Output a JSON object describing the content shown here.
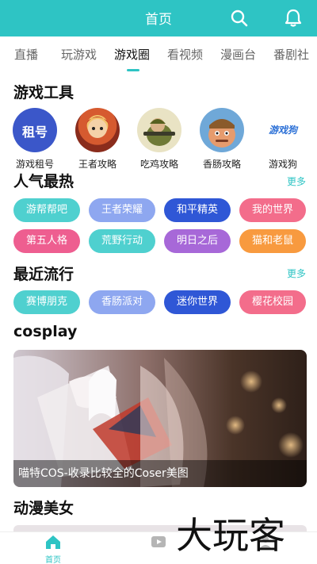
{
  "header": {
    "title": "首页",
    "accent_color": "#2ec4c4"
  },
  "tabs": [
    {
      "label": "直播"
    },
    {
      "label": "玩游戏"
    },
    {
      "label": "游戏圈"
    },
    {
      "label": "看视频"
    },
    {
      "label": "漫画台"
    },
    {
      "label": "番剧社"
    }
  ],
  "active_tab": "游戏圈",
  "tools": {
    "title": "游戏工具",
    "items": [
      {
        "label": "游戏租号",
        "icon": "rent-account-logo",
        "logo_text": "租号"
      },
      {
        "label": "王者攻略",
        "icon": "hero-avatar"
      },
      {
        "label": "吃鸡攻略",
        "icon": "soldier-avatar"
      },
      {
        "label": "香肠攻略",
        "icon": "sausage-man-avatar"
      },
      {
        "label": "游戏狗",
        "icon": "youxigou-logo",
        "logo_text": "游戏狗"
      }
    ]
  },
  "popular": {
    "title": "人气最热",
    "more": "更多",
    "items": [
      {
        "label": "游帮帮吧",
        "color": "#4fd0cf"
      },
      {
        "label": "王者荣耀",
        "color": "#8ea7f0"
      },
      {
        "label": "和平精英",
        "color": "#2f57d6"
      },
      {
        "label": "我的世界",
        "color": "#f36d8b"
      },
      {
        "label": "第五人格",
        "color": "#ee5e90"
      },
      {
        "label": "荒野行动",
        "color": "#4fd0cf"
      },
      {
        "label": "明日之后",
        "color": "#a768d8"
      },
      {
        "label": "猫和老鼠",
        "color": "#f89a3f"
      }
    ]
  },
  "recent": {
    "title": "最近流行",
    "more": "更多",
    "items": [
      {
        "label": "赛博朋克",
        "color": "#4fd0cf"
      },
      {
        "label": "香肠派对",
        "color": "#8ea7f0"
      },
      {
        "label": "迷你世界",
        "color": "#2f57d6"
      },
      {
        "label": "樱花校园",
        "color": "#f36d8b"
      }
    ]
  },
  "cosplay": {
    "title": "cosplay",
    "caption": "喵特COS-收录比较全的Coser美图"
  },
  "anime": {
    "title": "动漫美女"
  },
  "bottom_nav": [
    {
      "label": "首页",
      "icon": "home-icon",
      "active": true
    },
    {
      "label": "",
      "icon": "video-icon",
      "active": false
    },
    {
      "label": "",
      "icon": "profile-icon",
      "active": false
    }
  ],
  "watermark": "大玩客"
}
